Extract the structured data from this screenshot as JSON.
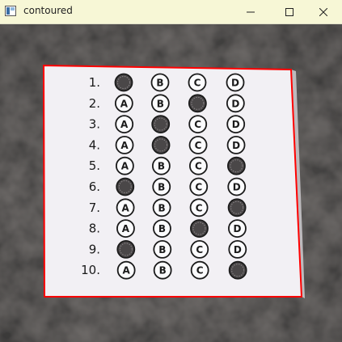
{
  "window": {
    "title": "contoured",
    "icons": {
      "app": "image-window-icon",
      "minimize": "minimize-icon",
      "maximize": "maximize-icon",
      "close": "close-icon"
    }
  },
  "image": {
    "description_label": "bubble-sheet",
    "contour_color": "#ff0000",
    "options": [
      "A",
      "B",
      "C",
      "D"
    ],
    "rows": [
      {
        "number": "1.",
        "filled": "A"
      },
      {
        "number": "2.",
        "filled": "C"
      },
      {
        "number": "3.",
        "filled": "B"
      },
      {
        "number": "4.",
        "filled": "B"
      },
      {
        "number": "5.",
        "filled": "D"
      },
      {
        "number": "6.",
        "filled": "A"
      },
      {
        "number": "7.",
        "filled": "D"
      },
      {
        "number": "8.",
        "filled": "C"
      },
      {
        "number": "9.",
        "filled": "A"
      },
      {
        "number": "10.",
        "filled": "D"
      }
    ]
  }
}
